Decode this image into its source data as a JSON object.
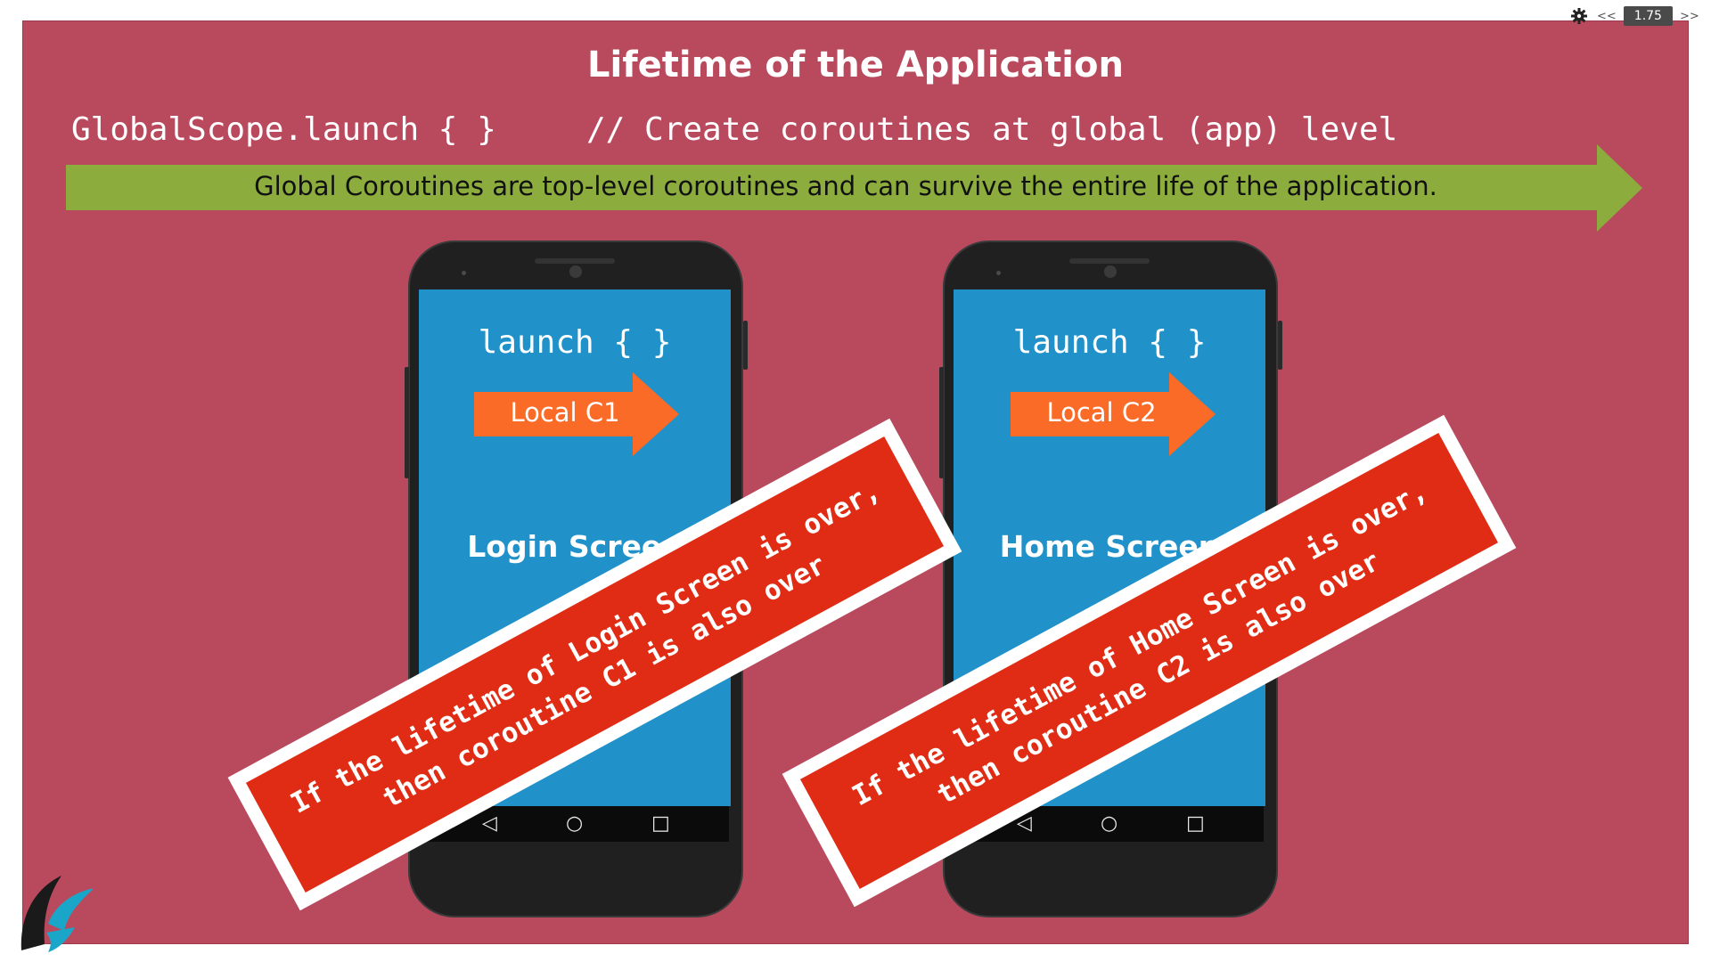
{
  "slide": {
    "title": "Lifetime of the Application",
    "code_left": "GlobalScope.launch { }",
    "code_comment": "// Create coroutines at global (app) level",
    "banner_text": "Global Coroutines are top-level coroutines and can survive the entire life of the application.",
    "colors": {
      "slide_background": "#b94a5e",
      "green_arrow": "#8cad3e",
      "orange_arrow": "#f96b26",
      "phone_screen": "#2191c9",
      "warning_banner": "#e02c14"
    }
  },
  "phones": [
    {
      "launch_text": "launch { }",
      "local_label": "Local C1",
      "screen_name": "Login Screen",
      "warning_line1": "If the lifetime of Login Screen is over,",
      "warning_line2": "then coroutine C1 is also over"
    },
    {
      "launch_text": "launch { }",
      "local_label": "Local C2",
      "screen_name": "Home Screen",
      "warning_line1": "If the lifetime of Home Screen is over,",
      "warning_line2": "then coroutine C2 is also over"
    }
  ],
  "nav_icons": {
    "back": "◁",
    "home": "○",
    "recents": "□"
  },
  "player": {
    "settings_icon": "gear-icon",
    "prev_label": "<<",
    "speed": "1.75",
    "next_label": ">>"
  }
}
